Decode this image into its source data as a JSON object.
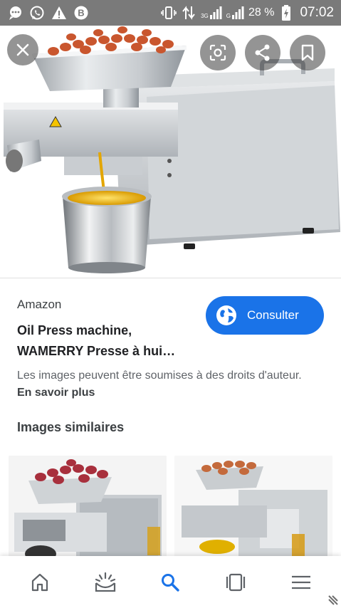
{
  "status_bar": {
    "icons": [
      "chat-bubble-icon",
      "whatsapp-icon",
      "warning-icon",
      "app-b-icon",
      "vibrate-icon",
      "data-arrows-icon",
      "signal-3g-icon",
      "signal-g-icon",
      "battery-charging-icon"
    ],
    "network_1": "3G",
    "network_2": "G",
    "battery_pct": "28 %",
    "time": "07:02"
  },
  "viewer": {
    "close_icon": "close-icon",
    "actions": [
      "lens-icon",
      "share-icon",
      "bookmark-icon"
    ]
  },
  "result": {
    "source": "Amazon",
    "title_line1": "Oil Press machine,",
    "title_line2": "WAMERRY Presse à hui…",
    "visit_label": "Consulter",
    "copyright_text": "Les images peuvent être soumises à des droits d'auteur.",
    "learn_more": "En savoir plus"
  },
  "similar": {
    "heading": "Images similaires"
  },
  "bottom_nav": {
    "items": [
      "home-icon",
      "discover-icon",
      "search-icon",
      "tabs-icon",
      "menu-icon"
    ],
    "active": "search-icon"
  },
  "colors": {
    "accent": "#1a73e8",
    "status_bar": "#7a7a7a",
    "text_primary": "#202124",
    "text_secondary": "#5f6368"
  }
}
